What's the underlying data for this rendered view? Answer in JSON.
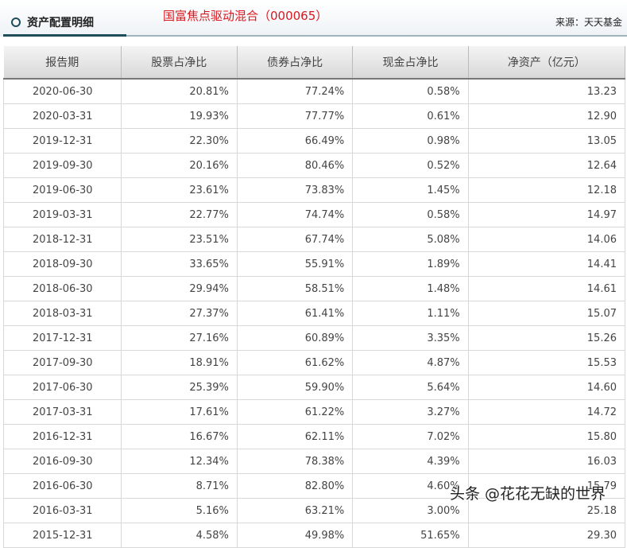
{
  "header": {
    "section_title": "资产配置明细",
    "fund_name": "国富焦点驱动混合（000065）",
    "source": "来源：天天基金"
  },
  "table": {
    "columns": [
      "报告期",
      "股票占净比",
      "债券占净比",
      "现金占净比",
      "净资产（亿元）"
    ],
    "rows": [
      [
        "2020-06-30",
        "20.81%",
        "77.24%",
        "0.58%",
        "13.23"
      ],
      [
        "2020-03-31",
        "19.93%",
        "77.77%",
        "0.61%",
        "12.90"
      ],
      [
        "2019-12-31",
        "22.30%",
        "66.49%",
        "0.98%",
        "13.05"
      ],
      [
        "2019-09-30",
        "20.16%",
        "80.46%",
        "0.52%",
        "12.64"
      ],
      [
        "2019-06-30",
        "23.61%",
        "73.83%",
        "1.45%",
        "12.18"
      ],
      [
        "2019-03-31",
        "22.77%",
        "74.74%",
        "0.58%",
        "14.97"
      ],
      [
        "2018-12-31",
        "23.51%",
        "67.74%",
        "5.08%",
        "14.06"
      ],
      [
        "2018-09-30",
        "33.65%",
        "55.91%",
        "1.89%",
        "14.41"
      ],
      [
        "2018-06-30",
        "29.94%",
        "58.51%",
        "1.48%",
        "14.61"
      ],
      [
        "2018-03-31",
        "27.37%",
        "61.41%",
        "1.11%",
        "15.07"
      ],
      [
        "2017-12-31",
        "27.16%",
        "60.89%",
        "3.35%",
        "15.26"
      ],
      [
        "2017-09-30",
        "18.91%",
        "61.62%",
        "4.87%",
        "15.53"
      ],
      [
        "2017-06-30",
        "25.39%",
        "59.90%",
        "5.64%",
        "14.60"
      ],
      [
        "2017-03-31",
        "17.61%",
        "61.22%",
        "3.27%",
        "14.72"
      ],
      [
        "2016-12-31",
        "16.67%",
        "62.11%",
        "7.02%",
        "15.80"
      ],
      [
        "2016-09-30",
        "12.34%",
        "78.38%",
        "4.39%",
        "16.03"
      ],
      [
        "2016-06-30",
        "8.71%",
        "82.80%",
        "4.60%",
        "15.79"
      ],
      [
        "2016-03-31",
        "5.16%",
        "63.21%",
        "3.00%",
        "25.18"
      ],
      [
        "2015-12-31",
        "4.58%",
        "49.98%",
        "51.65%",
        "29.30"
      ]
    ]
  },
  "watermark": "头条 @花花无缺的世界"
}
